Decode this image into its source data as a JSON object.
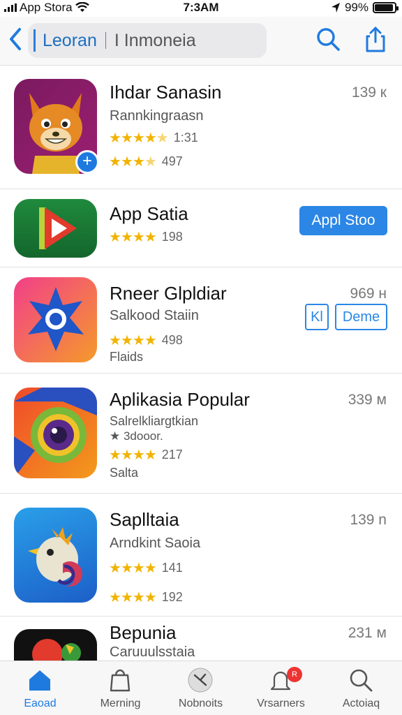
{
  "status_bar": {
    "carrier": "App Stora",
    "time": "7:3AM",
    "battery": "99%",
    "battery_level": 0.93
  },
  "nav": {
    "back_icon": "chevron-left-icon",
    "search_text": "Leoran",
    "search_query": "I Inmoneia",
    "search_icon": "search-icon",
    "share_icon": "share-icon"
  },
  "apps": [
    {
      "title": "Ihdar Sanasin",
      "subtitle": "Rannkingraasn",
      "size": "139 к",
      "ratings": [
        {
          "stars": 4.5,
          "count": "1:31"
        },
        {
          "stars": 3.5,
          "count": "497"
        }
      ],
      "icon": "fox-icon",
      "badge": "+"
    },
    {
      "title": "App Satia",
      "size": "",
      "ratings": [
        {
          "stars": 4,
          "count": "198"
        }
      ],
      "icon": "play-icon",
      "button": "Appl Stoo"
    },
    {
      "title": "Rneer Glpldiar",
      "subtitle": "Salkood Staiin",
      "size": "969 н",
      "ratings": [
        {
          "stars": 4,
          "count": "498"
        }
      ],
      "extra": "Flaids",
      "icon": "star-icon",
      "buttons": [
        "Kl",
        "Deme"
      ]
    },
    {
      "title": "Aplikasia Popular",
      "subtitle": "Salrelkliargtkian",
      "subtitle2": "★ 3dooor.",
      "size": "339 м",
      "ratings": [
        {
          "stars": 4,
          "count": "217"
        }
      ],
      "extra": "Salta",
      "icon": "camera-lens-icon"
    },
    {
      "title": "Saplltaia",
      "subtitle": "Arndkint Saoia",
      "size": "139 n",
      "ratings": [
        {
          "stars": 4,
          "count": "141"
        },
        {
          "stars": 4,
          "count": "192"
        }
      ],
      "icon": "bird-icon"
    },
    {
      "title": "Bepunia",
      "subtitle": "Caruuulsstaia",
      "size": "231 м",
      "icon": "frog-icon"
    }
  ],
  "tabs": [
    {
      "label": "Eaoad",
      "icon": "home-icon",
      "active": true
    },
    {
      "label": "Merning",
      "icon": "bag-icon",
      "active": false
    },
    {
      "label": "Nobnoits",
      "icon": "clock-icon",
      "active": false
    },
    {
      "label": "Vrsarners",
      "icon": "bell-icon",
      "active": false,
      "badge": "R"
    },
    {
      "label": "Actoiaq",
      "icon": "search-icon",
      "active": false
    }
  ],
  "colors": {
    "accent": "#2b86e6",
    "star": "#f0b400",
    "badge": "#e33333"
  }
}
